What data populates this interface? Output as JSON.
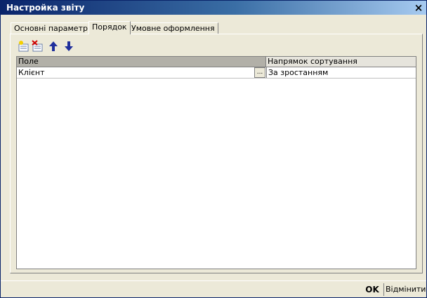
{
  "window": {
    "title": "Настройка звіту",
    "close_glyph": "×"
  },
  "tabs": [
    {
      "label": "Основні параметри",
      "active": false
    },
    {
      "label": "Порядок",
      "active": true
    },
    {
      "label": "Умовне оформлення",
      "active": false
    }
  ],
  "toolbar": {
    "buttons": [
      "add-row-icon",
      "delete-row-icon",
      "move-up-icon",
      "move-down-icon"
    ]
  },
  "table": {
    "columns": [
      "Поле",
      "Напрямок сортування"
    ],
    "rows": [
      {
        "field": "Клієнт",
        "select_glyph": "...",
        "direction": "За зростанням"
      }
    ]
  },
  "footer": {
    "ok_label": "OK",
    "cancel_label": "Відмінити"
  },
  "colors": {
    "title_start": "#0a246a",
    "title_end": "#a6caf0",
    "face": "#ece9d8"
  }
}
